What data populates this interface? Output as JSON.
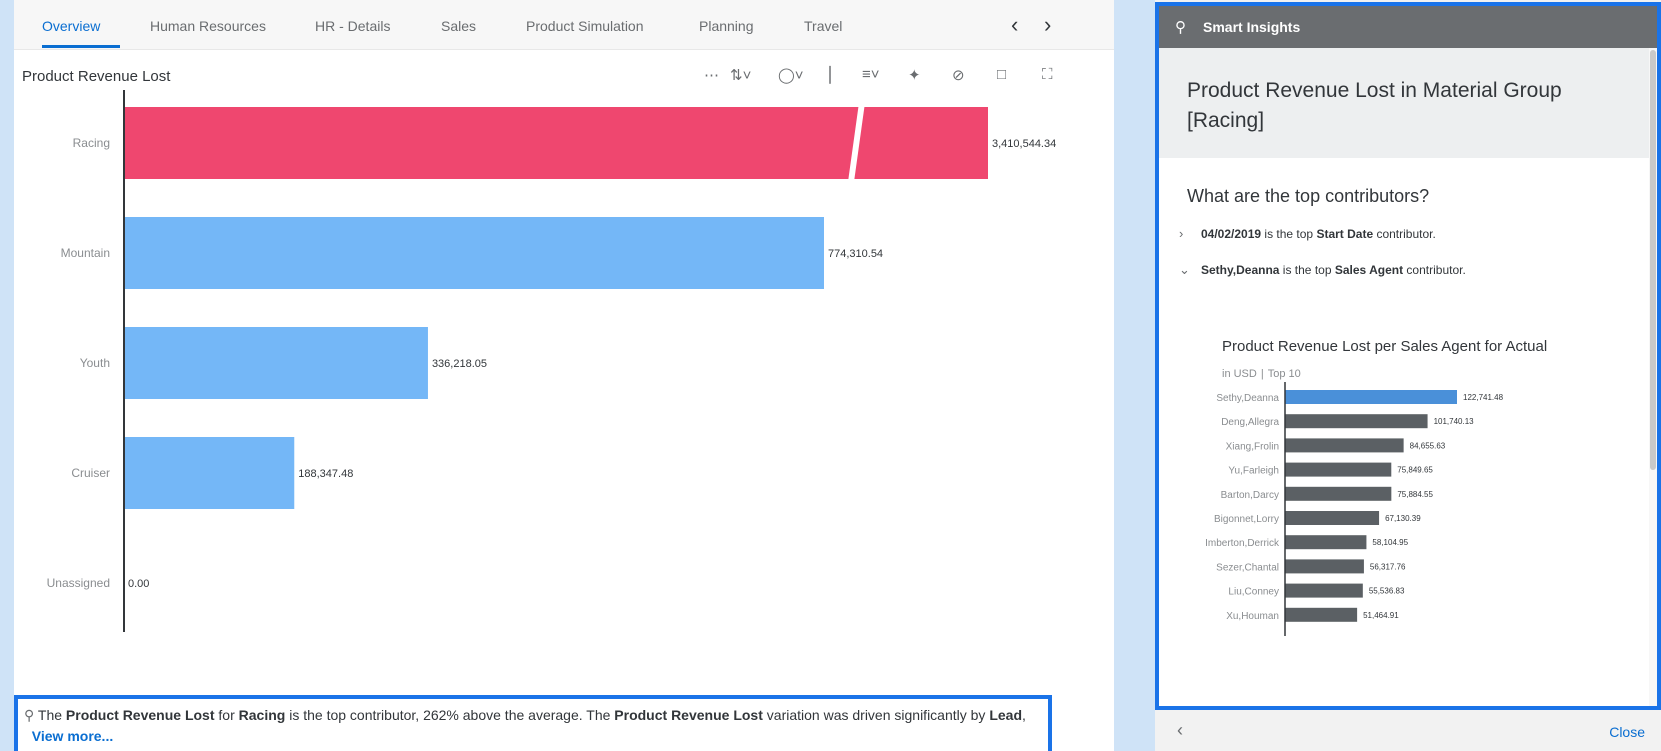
{
  "tabs": {
    "items": [
      "Overview",
      "Human Resources",
      "HR - Details",
      "Sales",
      "Product Simulation",
      "Planning",
      "Travel"
    ],
    "active": "Overview",
    "prev_icon": "chevron-left-icon",
    "next_icon": "chevron-right-icon"
  },
  "main": {
    "title": "Product Revenue Lost",
    "toolbar_icons": [
      "more-icon",
      "sort-icon",
      "insight-icon",
      "ruler-icon",
      "filter-icon",
      "pin-icon",
      "compass-icon",
      "comment-icon",
      "fullscreen-icon"
    ]
  },
  "chart_data": [
    {
      "type": "bar",
      "orientation": "horizontal",
      "title": "Product Revenue Lost",
      "categories": [
        "Racing",
        "Mountain",
        "Youth",
        "Cruiser",
        "Unassigned"
      ],
      "values": [
        3410544.34,
        774310.54,
        336218.05,
        188347.48,
        0.0
      ],
      "data_labels": [
        "3,410,544.34",
        "774,310.54",
        "336,218.05",
        "188,347.48",
        "0.00"
      ],
      "highlight": "Racing",
      "axis_break": true,
      "colors": {
        "highlight": "#ef476f",
        "normal": "#74b7f7"
      }
    },
    {
      "type": "bar",
      "orientation": "horizontal",
      "title": "Product Revenue Lost per Sales Agent for Actual",
      "subtitle_unit": "in USD",
      "subtitle_filter": "Top 10",
      "categories": [
        "Sethy,Deanna",
        "Deng,Allegra",
        "Xiang,Frolin",
        "Yu,Farleigh",
        "Barton,Darcy",
        "Bigonnet,Lorry",
        "Imberton,Derrick",
        "Sezer,Chantal",
        "Liu,Conney",
        "Xu,Houman"
      ],
      "values": [
        122741.48,
        101740.13,
        84655.63,
        75849.65,
        75884.55,
        67130.39,
        58104.95,
        56317.76,
        55536.83,
        51464.91
      ],
      "data_labels": [
        "122,741.48",
        "101,740.13",
        "84,655.63",
        "75,849.65",
        "75,884.55",
        "67,130.39",
        "58,104.95",
        "56,317.76",
        "55,536.83",
        "51,464.91"
      ],
      "highlight": "Sethy,Deanna",
      "colors": {
        "highlight": "#4a90d9",
        "normal": "#5b6064"
      }
    }
  ],
  "insight": {
    "icon": "lightbulb-icon",
    "t1": "The ",
    "b1": "Product Revenue Lost",
    "t2": " for ",
    "b2": "Racing",
    "t3": " is the top contributor, 262% above the average. The ",
    "b3": "Product Revenue Lost",
    "t4": " variation was driven significantly by ",
    "b4": "Lead",
    "t5": ", ",
    "link": "View more..."
  },
  "panel": {
    "header_icon": "lightbulb-icon",
    "header_title": "Smart Insights",
    "title": "Product Revenue Lost in Material Group [Racing]",
    "question": "What are the top contributors?",
    "contributors": [
      {
        "value": "04/02/2019",
        "mid": " is the top ",
        "dim": "Start Date",
        "end": " contributor.",
        "expanded": false
      },
      {
        "value": "Sethy,Deanna",
        "mid": " is the top ",
        "dim": "Sales Agent",
        "end": " contributor.",
        "expanded": true
      }
    ],
    "back_icon": "chevron-left-icon",
    "close_label": "Close"
  }
}
